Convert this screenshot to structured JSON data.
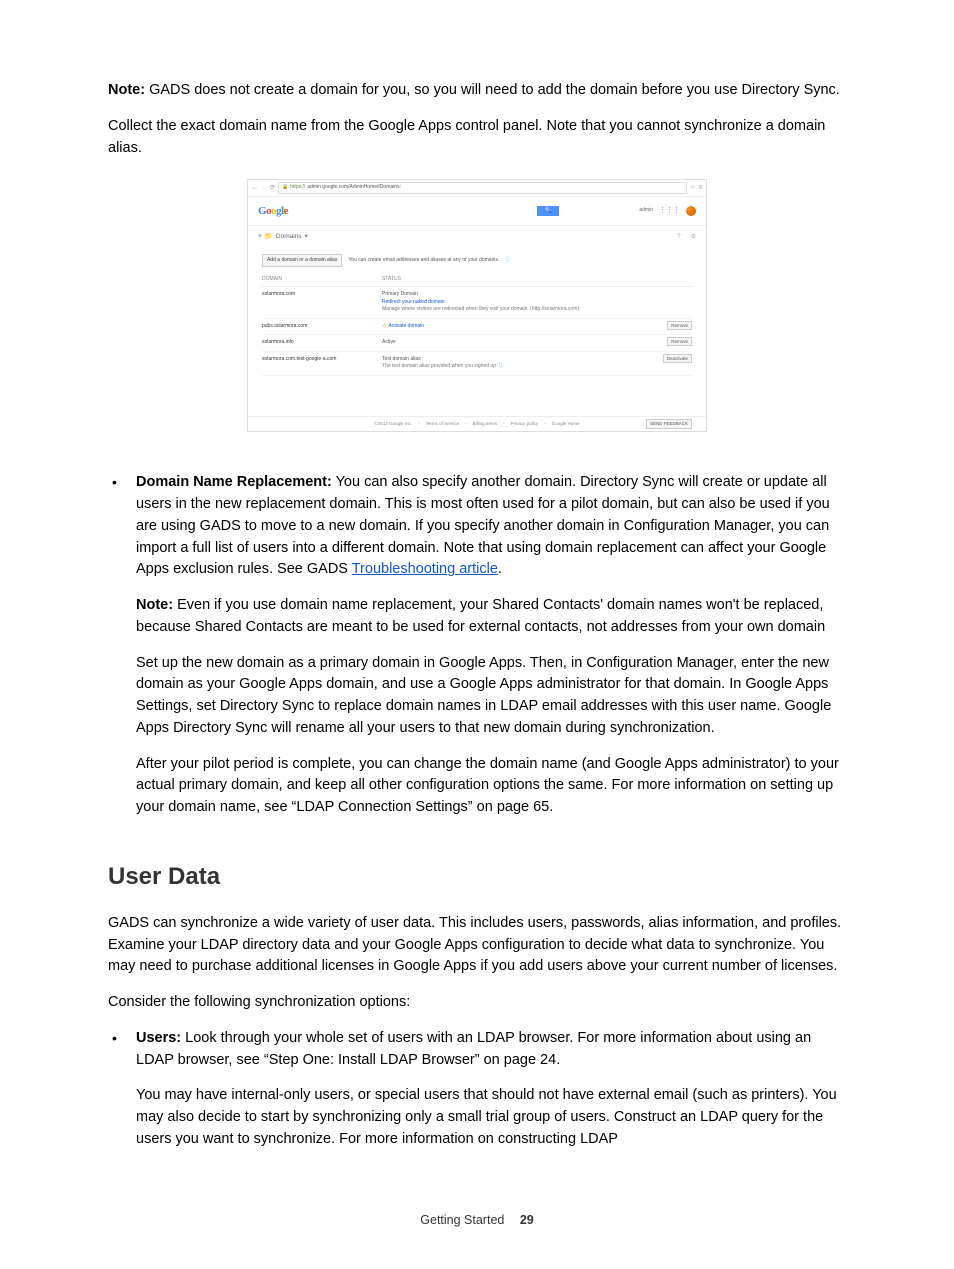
{
  "paragraphs": {
    "note1_label": "Note:",
    "note1_text": " GADS does not create a domain for you, so you will need to add the domain before you use Directory Sync.",
    "p2": "Collect the exact domain name from the Google Apps control panel. Note that you cannot synchronize a domain alias."
  },
  "screenshot": {
    "url_prefix": "https://",
    "url": "admin.google.com/AdminHome#Domains:",
    "logo": "Google",
    "header_user": "admin",
    "breadcrumb_arrow": "≡",
    "breadcrumb": "Domains",
    "add_button": "Add a domain or a domain alias",
    "add_hint": "You can create email addresses and aliases at any of your domains.",
    "col_domain": "DOMAIN",
    "col_status": "STATUS",
    "rows": [
      {
        "domain": "solarmora.com",
        "status_title": "Primary Domain",
        "status_link": "Redirect your naked domain",
        "status_sub": "Manage where visitors are redirected when they visit your domain. (http://solarmora.com)",
        "action": ""
      },
      {
        "domain": "pubs.solarmora.com",
        "status_warn": true,
        "status_link": "Activate domain",
        "action": "Remove"
      },
      {
        "domain": "solarmora.info",
        "status_title": "Active",
        "action": "Remove"
      },
      {
        "domain": "solarmora.com.test-google-a.com",
        "status_title": "Test domain alias",
        "status_sub": "The test domain alias provided when you signed up.",
        "status_help": true,
        "action": "Deactivate"
      }
    ],
    "footer_copy": "©2013 Google Inc.",
    "footer_links": [
      "Terms of Service",
      "Billing terms",
      "Privacy policy",
      "Google Home"
    ],
    "feedback": "SEND FEEDBACK"
  },
  "bullet1": {
    "label": "Domain Name Replacement:",
    "text": " You can also specify another domain. Directory Sync will create or update all users in the new replacement domain. This is most often used for a pilot domain, but can also be used if you are using GADS to move to a new domain. If you specify another domain in Configuration Manager, you can import a full list of users into a different domain. Note that using domain replacement can affect your Google Apps exclusion rules. See GADS ",
    "link": "Troubleshooting article",
    "tail": ".",
    "note_label": "Note:",
    "note_text": " Even if you use domain name replacement, your Shared Contacts' domain names won't be replaced, because Shared Contacts are meant to be used for external contacts, not addresses from your own domain",
    "p3": "Set up the new domain as a primary domain in Google Apps. Then, in Configuration Manager, enter the new domain as your Google Apps domain, and use a Google Apps administrator for that domain. In Google Apps Settings, set Directory Sync to replace domain names in LDAP email addresses with this user name. Google Apps Directory Sync will rename all your users to that new domain during synchronization.",
    "p4": "After your pilot period is complete, you can change the domain name (and Google Apps administrator) to your actual primary domain, and keep all other configuration options the same. For more information on setting up your domain name, see “LDAP Connection Settings” on page 65."
  },
  "section2": {
    "heading": "User Data",
    "p1": "GADS can synchronize a wide variety of user data. This includes users, passwords, alias information, and profiles. Examine your LDAP directory data and your Google Apps configuration to decide what data to synchronize. You may need to purchase additional licenses in Google Apps if you add users above your current number of licenses.",
    "p2": "Consider the following synchronization options:"
  },
  "bullet2": {
    "label": "Users:",
    "text": " Look through your whole set of users with an LDAP browser. For more information about using an LDAP browser, see “Step One: Install LDAP Browser” on page 24.",
    "p2": "You may have internal-only users, or special users that should not have external email (such as printers). You may also decide to start by synchronizing only a small trial group of users. Construct an LDAP query for the users you want to synchronize. For more information on constructing LDAP"
  },
  "footer": {
    "section": "Getting Started",
    "page": "29"
  }
}
